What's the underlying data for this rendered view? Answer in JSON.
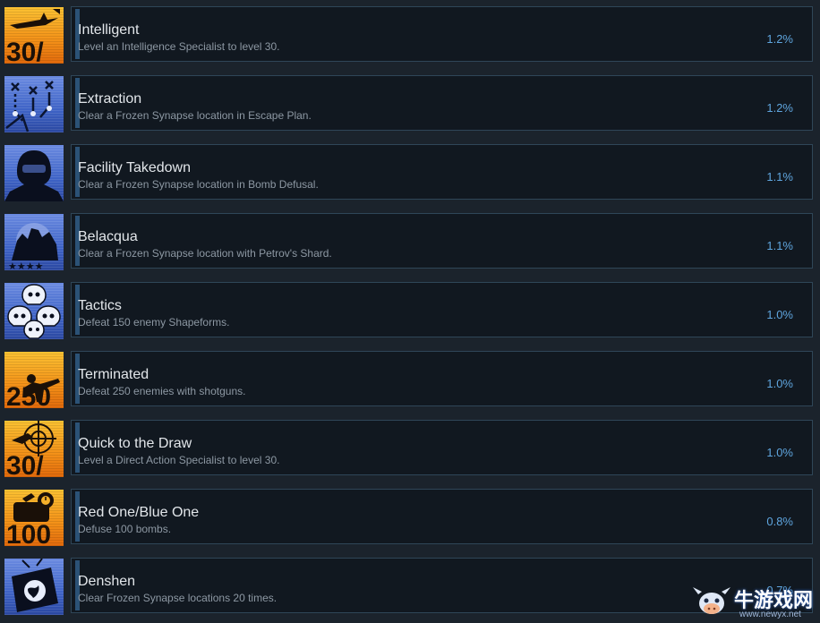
{
  "achievements": [
    {
      "title": "Intelligent",
      "desc": "Level an Intelligence Specialist to level 30.",
      "pct": "1.2%",
      "icon": "intelligence-specialist-icon",
      "icon_theme": "orange",
      "icon_text": "30/"
    },
    {
      "title": "Extraction",
      "desc": "Clear a Frozen Synapse location in Escape Plan.",
      "pct": "1.2%",
      "icon": "escape-plan-routes-icon",
      "icon_theme": "blue",
      "icon_text": ""
    },
    {
      "title": "Facility Takedown",
      "desc": "Clear a Frozen Synapse location in Bomb Defusal.",
      "pct": "1.1%",
      "icon": "masked-soldier-icon",
      "icon_theme": "blue",
      "icon_text": ""
    },
    {
      "title": "Belacqua",
      "desc": "Clear a Frozen Synapse location with Petrov's Shard.",
      "pct": "1.1%",
      "icon": "squad-stars-icon",
      "icon_theme": "blue",
      "icon_text": ""
    },
    {
      "title": "Tactics",
      "desc": "Defeat 150 enemy Shapeforms.",
      "pct": "1.0%",
      "icon": "skulls-icon",
      "icon_theme": "blue",
      "icon_text": ""
    },
    {
      "title": "Terminated",
      "desc": "Defeat 250 enemies with shotguns.",
      "pct": "1.0%",
      "icon": "shotgun-soldier-icon",
      "icon_theme": "orange",
      "icon_text": "250"
    },
    {
      "title": "Quick to the Draw",
      "desc": "Level a Direct Action Specialist to level 30.",
      "pct": "1.0%",
      "icon": "crosshair-target-icon",
      "icon_theme": "orange",
      "icon_text": "30/"
    },
    {
      "title": "Red One/Blue One",
      "desc": "Defuse 100 bombs.",
      "pct": "0.8%",
      "icon": "bomb-icon",
      "icon_theme": "orange",
      "icon_text": "100"
    },
    {
      "title": "Denshen",
      "desc": "Clear Frozen Synapse locations 20 times.",
      "pct": "0.7%",
      "icon": "globe-tv-icon",
      "icon_theme": "blue",
      "icon_text": ""
    }
  ],
  "watermark": {
    "text": "牛游戏网",
    "url": "www.newyx.net",
    "icon": "cow-mascot-icon"
  },
  "colors": {
    "background": "#1b232c",
    "panel": "#111820",
    "border": "#2f4658",
    "accent": "#2b5276",
    "percent": "#5fa5de"
  }
}
